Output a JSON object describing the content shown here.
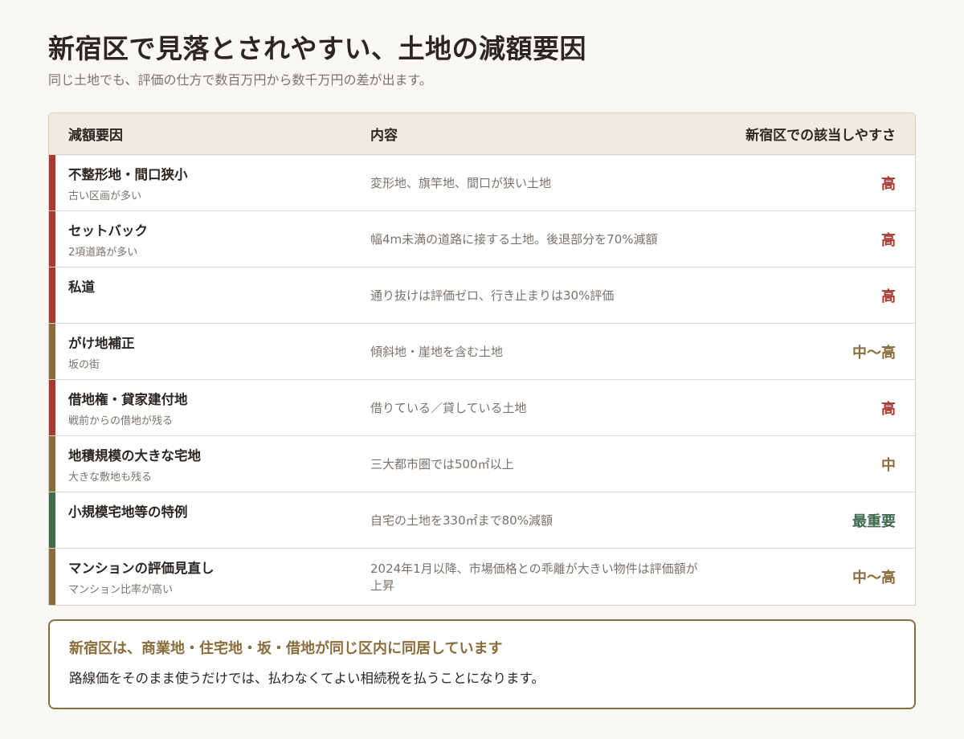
{
  "header": {
    "title": "新宿区で見落とされやすい、土地の減額要因",
    "subtitle": "同じ土地でも、評価の仕方で数百万円から数千万円の差が出ます。"
  },
  "table": {
    "columns": [
      "減額要因",
      "内容",
      "新宿区での該当しやすさ"
    ],
    "rows": [
      {
        "factor": "不整形地・間口狭小",
        "note": "古い区画が多い",
        "description": "変形地、旗竿地、間口が狭い土地",
        "likelihood": "高",
        "color": "#a83a32"
      },
      {
        "factor": "セットバック",
        "note": "2項道路が多い",
        "description": "幅4m未満の道路に接する土地。後退部分を70%減額",
        "likelihood": "高",
        "color": "#a83a32"
      },
      {
        "factor": "私道",
        "note": "",
        "description": "通り抜けは評価ゼロ、行き止まりは30%評価",
        "likelihood": "高",
        "color": "#a83a32"
      },
      {
        "factor": "がけ地補正",
        "note": "坂の街",
        "description": "傾斜地・崖地を含む土地",
        "likelihood": "中〜高",
        "color": "#8a6d3b"
      },
      {
        "factor": "借地権・貸家建付地",
        "note": "戦前からの借地が残る",
        "description": "借りている／貸している土地",
        "likelihood": "高",
        "color": "#a83a32"
      },
      {
        "factor": "地積規模の大きな宅地",
        "note": "大きな敷地も残る",
        "description": "三大都市圏では500㎡以上",
        "likelihood": "中",
        "color": "#8a6d3b"
      },
      {
        "factor": "小規模宅地等の特例",
        "note": "",
        "description": "自宅の土地を330㎡まで80%減額",
        "likelihood": "最重要",
        "color": "#3e6b4f"
      },
      {
        "factor": "マンションの評価見直し",
        "note": "マンション比率が高い",
        "description": "2024年1月以降、市場価格との乖離が大きい物件は評価額が上昇",
        "likelihood": "中〜高",
        "color": "#8a6d3b"
      }
    ]
  },
  "callout": {
    "title": "新宿区は、商業地・住宅地・坂・借地が同じ区内に同居しています",
    "body": "路線価をそのまま使うだけでは、払わなくてよい相続税を払うことになります。"
  }
}
